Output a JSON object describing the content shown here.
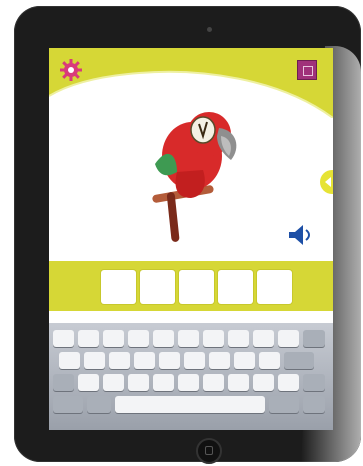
{
  "app": {
    "top_wave_color": "#d6d736",
    "accent_color": "#d6d736",
    "gear_color": "#d93a7b",
    "menu_color": "#a0317a"
  },
  "toolbar": {
    "settings_icon": "gear-icon",
    "menu_icon": "menu-square-icon"
  },
  "picture": {
    "subject": "parrot-illustration",
    "colors": {
      "body": "#d82a2a",
      "wing": "#3e9a52",
      "beak": "#9a9a9a",
      "perch": "#b45c3a"
    }
  },
  "controls": {
    "speaker_icon": "speaker-icon",
    "next_arrow_icon": "arrow-left-icon"
  },
  "answer": {
    "slots": [
      "",
      "",
      "",
      "",
      ""
    ]
  },
  "keyboard": {
    "rows": [
      [
        "",
        "",
        "",
        "",
        "",
        "",
        "",
        "",
        "",
        "",
        ""
      ],
      [
        "",
        "",
        "",
        "",
        "",
        "",
        "",
        "",
        "",
        "",
        ""
      ],
      [
        "",
        "",
        "",
        "",
        "",
        "",
        "",
        "",
        "",
        "",
        ""
      ],
      [
        "",
        "",
        "",
        "",
        ""
      ]
    ]
  }
}
